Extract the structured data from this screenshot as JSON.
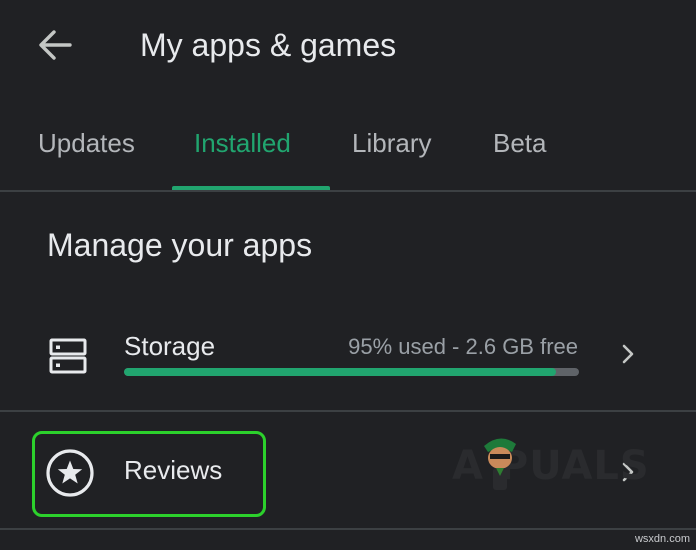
{
  "appbar": {
    "back_icon": "arrow-left-icon",
    "title": "My apps & games"
  },
  "tabs": [
    {
      "label": "Updates",
      "active": false
    },
    {
      "label": "Installed",
      "active": true
    },
    {
      "label": "Library",
      "active": false
    },
    {
      "label": "Beta",
      "active": false
    }
  ],
  "section": {
    "title": "Manage your apps"
  },
  "storage": {
    "icon": "storage-icon",
    "label": "Storage",
    "detail": "95% used - 2.6 GB free",
    "used_percent": 95
  },
  "reviews": {
    "icon": "star-circle-icon",
    "label": "Reviews"
  },
  "watermark": {
    "text": "A PUALS",
    "site": "wsxdn.com"
  },
  "colors": {
    "background": "#202124",
    "accent": "#21a56f",
    "highlight": "#2cd12c",
    "text_primary": "#e8eaed",
    "text_secondary": "#9aa0a6",
    "divider": "#3c4043"
  }
}
